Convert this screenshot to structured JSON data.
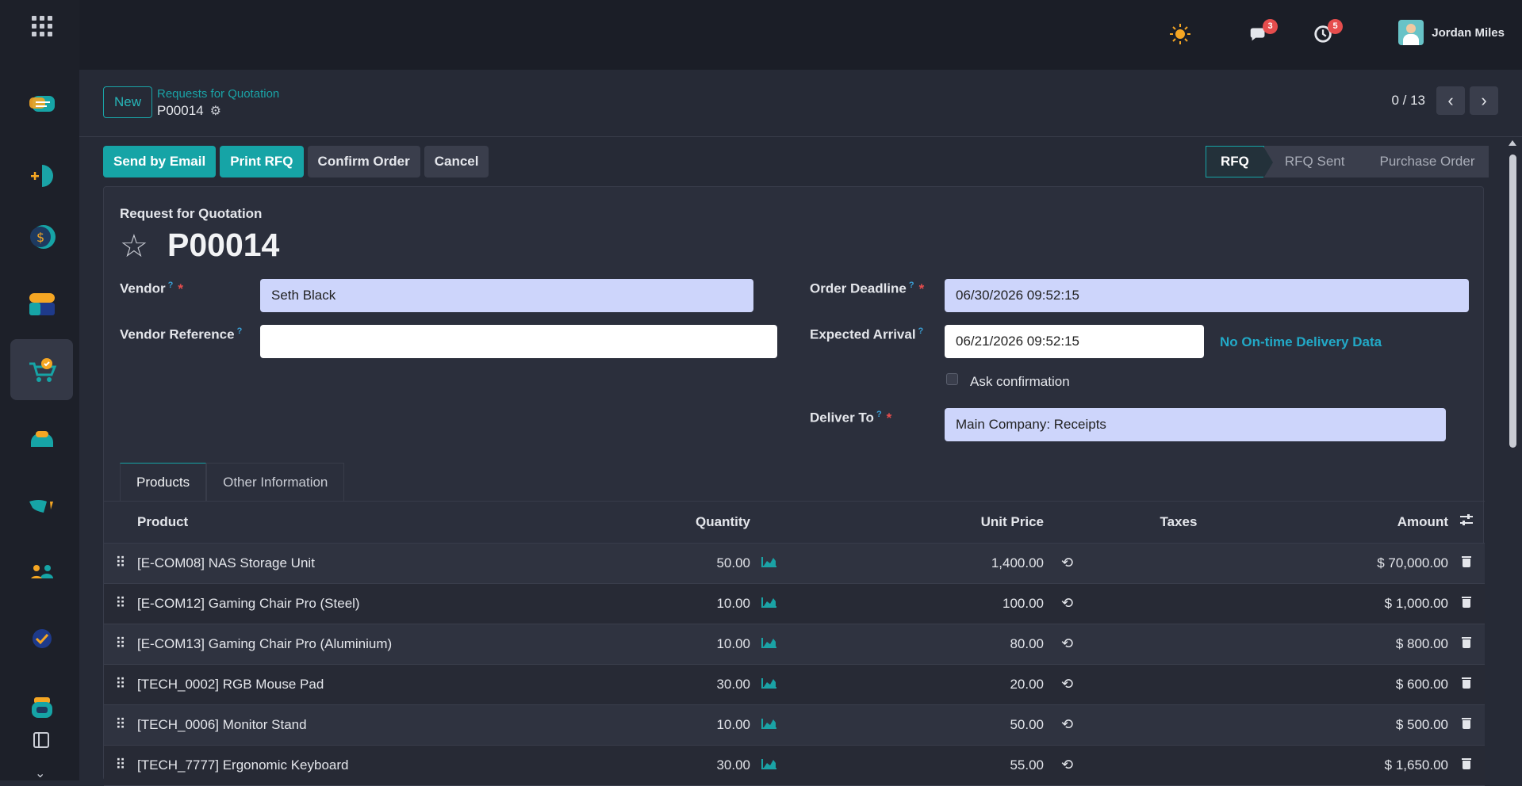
{
  "user": {
    "name": "Jordan Miles"
  },
  "notifications": {
    "messages_count": "3",
    "activities_count": "5"
  },
  "control_panel": {
    "new_label": "New",
    "breadcrumb": "Requests for Quotation",
    "record_name": "P00014",
    "pager_value": "0 / 13"
  },
  "actions": {
    "send_email": "Send by Email",
    "print_rfq": "Print RFQ",
    "confirm_order": "Confirm Order",
    "cancel": "Cancel"
  },
  "statusbar": {
    "stages": [
      "RFQ",
      "RFQ Sent",
      "Purchase Order"
    ],
    "current": "RFQ"
  },
  "form": {
    "doc_type": "Request for Quotation",
    "doc_name": "P00014",
    "vendor_label": "Vendor",
    "vendor_value": "Seth Black",
    "vendor_ref_label": "Vendor Reference",
    "vendor_ref_value": "",
    "order_deadline_label": "Order Deadline",
    "order_deadline_value": "06/30/2026 09:52:15",
    "expected_arrival_label": "Expected Arrival",
    "expected_arrival_value": "06/21/2026 09:52:15",
    "ontime_text": "No On-time Delivery Data",
    "ask_confirmation_label": "Ask confirmation",
    "deliver_to_label": "Deliver To",
    "deliver_to_value": "Main Company: Receipts"
  },
  "tabs": {
    "products": "Products",
    "other_info": "Other Information"
  },
  "lines": {
    "headers": {
      "product": "Product",
      "quantity": "Quantity",
      "unit_price": "Unit Price",
      "taxes": "Taxes",
      "amount": "Amount"
    },
    "rows": [
      {
        "product": "[E-COM08] NAS Storage Unit",
        "quantity": "50.00",
        "unit_price": "1,400.00",
        "taxes": "",
        "amount": "$ 70,000.00"
      },
      {
        "product": "[E-COM12] Gaming Chair Pro (Steel)",
        "quantity": "10.00",
        "unit_price": "100.00",
        "taxes": "",
        "amount": "$ 1,000.00"
      },
      {
        "product": "[E-COM13] Gaming Chair Pro (Aluminium)",
        "quantity": "10.00",
        "unit_price": "80.00",
        "taxes": "",
        "amount": "$ 800.00"
      },
      {
        "product": "[TECH_0002] RGB Mouse Pad",
        "quantity": "30.00",
        "unit_price": "20.00",
        "taxes": "",
        "amount": "$ 600.00"
      },
      {
        "product": "[TECH_0006] Monitor Stand",
        "quantity": "10.00",
        "unit_price": "50.00",
        "taxes": "",
        "amount": "$ 500.00"
      },
      {
        "product": "[TECH_7777] Ergonomic Keyboard",
        "quantity": "30.00",
        "unit_price": "55.00",
        "taxes": "",
        "amount": "$ 1,650.00"
      }
    ]
  },
  "icons": {
    "apps": "grid-icon",
    "theme": "sun-icon",
    "messages": "chat-icon",
    "activities": "clock-icon",
    "favorite": "star-icon",
    "settings": "gear-icon",
    "forecast": "area-chart-icon",
    "history": "history-icon",
    "delete": "trash-icon"
  },
  "colors": {
    "accent": "#16a4a6",
    "required_field": "#cdd5fb",
    "badge": "#e64d4d",
    "link": "#22a9c7"
  }
}
